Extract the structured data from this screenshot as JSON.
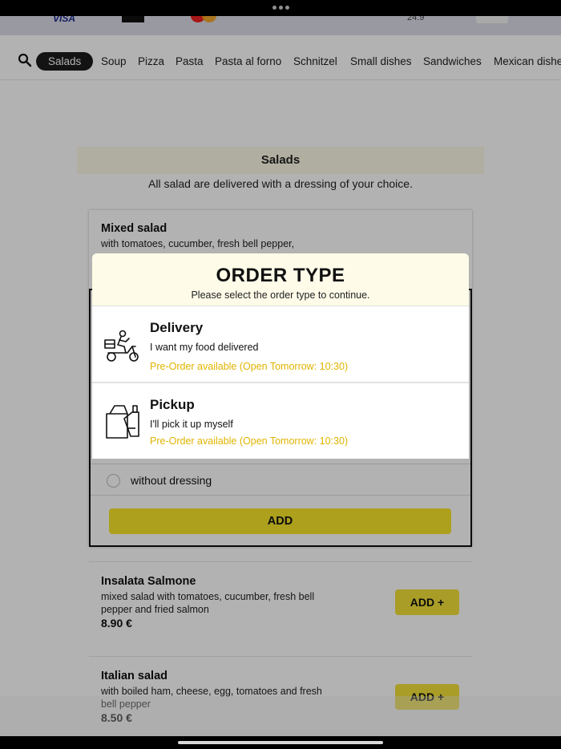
{
  "payment_strip": {
    "visa": "VISA",
    "date": "24.9"
  },
  "categories": [
    "Salads",
    "Soup",
    "Pizza",
    "Pasta",
    "Pasta al forno",
    "Schnitzel",
    "Small dishes",
    "Sandwiches",
    "Mexican dishe"
  ],
  "active_category": "Salads",
  "section": {
    "title": "Salads",
    "description": "All salad are delivered with a dressing of your choice."
  },
  "expanded_item": {
    "name": "Mixed salad",
    "description": "with tomatoes, cucumber, fresh bell pepper,",
    "option_label": "without dressing",
    "add_label": "ADD"
  },
  "items": [
    {
      "name": "Insalata Salmone",
      "description": "mixed salad with tomatoes, cucumber, fresh bell pepper and fried salmon",
      "price": "8.90 €",
      "add_label": "ADD +"
    },
    {
      "name": "Italian salad",
      "description": "with boiled ham, cheese, egg, tomatoes and fresh bell pepper",
      "price": "8.50 €",
      "add_label": "ADD +"
    }
  ],
  "modal": {
    "title": "ORDER TYPE",
    "subtitle": "Please select the order type to continue.",
    "options": [
      {
        "title": "Delivery",
        "description": "I want my food delivered",
        "preorder": "Pre-Order available (Open Tomorrow: 10:30)",
        "icon": "delivery-scooter-icon"
      },
      {
        "title": "Pickup",
        "description": "I'll pick it up myself",
        "preorder": "Pre-Order available (Open Tomorrow: 10:30)",
        "icon": "pickup-bag-icon"
      }
    ]
  },
  "colors": {
    "accent_yellow": "#f2e13a",
    "preorder_text": "#e0b400",
    "active_chip": "#1c1c1c",
    "modal_header_bg": "#fefbe8"
  }
}
